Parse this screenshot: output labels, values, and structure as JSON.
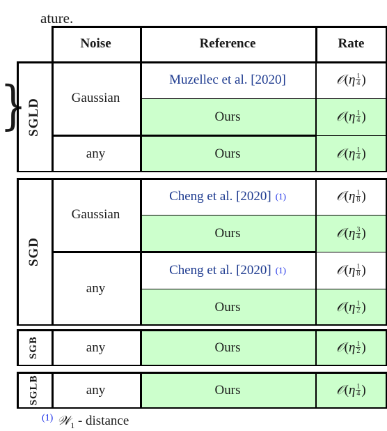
{
  "preceding_text": "ature.",
  "table": {
    "headers": {
      "noise": "Noise",
      "reference": "Reference",
      "rate": "Rate"
    },
    "groups": [
      {
        "algorithm": "SGLD",
        "rows": [
          {
            "noise": "Gaussian",
            "reference": "Muzellec et al. [2020]",
            "footnote": "",
            "rate_exponent_num": "1",
            "rate_exponent_den": "4",
            "highlight": false
          },
          {
            "noise": "Gaussian",
            "reference": "Ours",
            "footnote": "",
            "rate_exponent_num": "1",
            "rate_exponent_den": "4",
            "highlight": true
          },
          {
            "noise": "any",
            "reference": "Ours",
            "footnote": "",
            "rate_exponent_num": "1",
            "rate_exponent_den": "4",
            "highlight": true
          }
        ]
      },
      {
        "algorithm": "SGD",
        "rows": [
          {
            "noise": "Gaussian",
            "reference": "Cheng et al. [2020]",
            "footnote": "(1)",
            "rate_exponent_num": "1",
            "rate_exponent_den": "8",
            "highlight": false
          },
          {
            "noise": "Gaussian",
            "reference": "Ours",
            "footnote": "",
            "rate_exponent_num": "3",
            "rate_exponent_den": "4",
            "highlight": true
          },
          {
            "noise": "any",
            "reference": "Cheng et al. [2020]",
            "footnote": "(1)",
            "rate_exponent_num": "1",
            "rate_exponent_den": "8",
            "highlight": false
          },
          {
            "noise": "any",
            "reference": "Ours",
            "footnote": "",
            "rate_exponent_num": "1",
            "rate_exponent_den": "2",
            "highlight": true
          }
        ]
      },
      {
        "algorithm": "SGB",
        "rows": [
          {
            "noise": "any",
            "reference": "Ours",
            "footnote": "",
            "rate_exponent_num": "1",
            "rate_exponent_den": "2",
            "highlight": true
          }
        ]
      },
      {
        "algorithm": "SGLB",
        "rows": [
          {
            "noise": "any",
            "reference": "Ours",
            "footnote": "",
            "rate_exponent_num": "1",
            "rate_exponent_den": "4",
            "highlight": true
          }
        ]
      }
    ],
    "rate_prefix": "𝒪(η",
    "rate_suffix": ")"
  },
  "footnote": {
    "mark": "(1)",
    "symbol": "𝒲",
    "subscript": "1",
    "text": " - distance"
  },
  "colors": {
    "highlight": "#ccffcc",
    "citation": "#1d3a8f",
    "footnote_mark": "#1a2ee8"
  }
}
